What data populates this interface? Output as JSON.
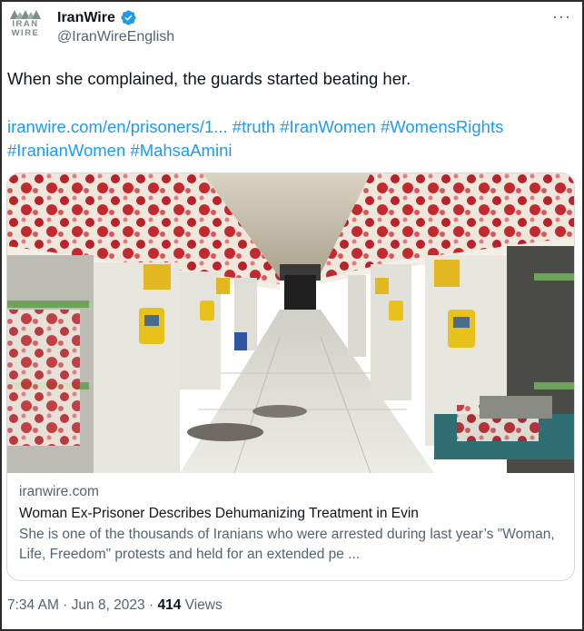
{
  "author": {
    "name": "IranWire",
    "handle": "@IranWireEnglish",
    "logo_lines": [
      "IRAN",
      "WIRE"
    ]
  },
  "more_label": "···",
  "tweet": {
    "text": "When she complained, the guards started beating her.",
    "link": "iranwire.com/en/prisoners/1...",
    "hashtags": [
      "#truth",
      "#IranWomen",
      "#WomensRights",
      "#IranianWomen",
      "#MahsaAmini"
    ]
  },
  "card": {
    "domain": "iranwire.com",
    "title": "Woman Ex-Prisoner Describes Dehumanizing Treatment in Evin",
    "description": "She is one of the thousands of Iranians who were arrested during last year’s \"Woman, Life, Freedom\" protests and held for an extended pe ..."
  },
  "footer": {
    "time": "7:34 AM",
    "separator1": " · ",
    "date": "Jun 8, 2023",
    "separator2": " · ",
    "views_count": "414",
    "views_label": " Views"
  },
  "colors": {
    "link": "#1d9bf0",
    "verified": "#1d9bf0",
    "secondary_text": "#536471",
    "logo": "#7a8f85"
  }
}
